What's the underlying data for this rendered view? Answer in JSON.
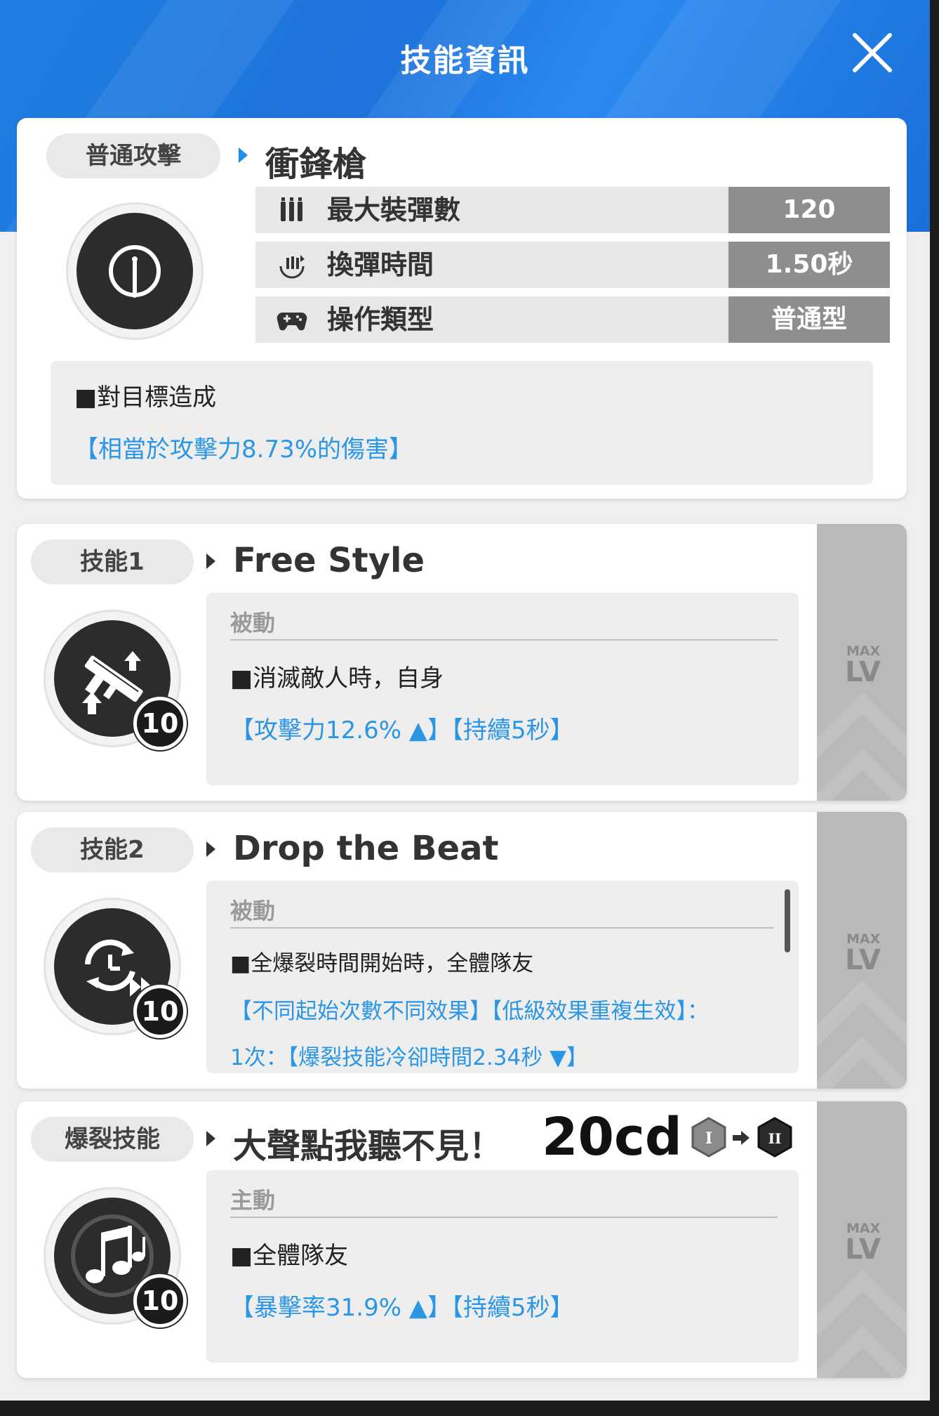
{
  "header": {
    "title": "技能資訊",
    "close_icon": "close-icon"
  },
  "basic_attack": {
    "tag": "普通攻擊",
    "weapon_name": "衝鋒槍",
    "stats": [
      {
        "icon": "ammo-icon",
        "label": "最大裝彈數",
        "value": "120"
      },
      {
        "icon": "reload-icon",
        "label": "換彈時間",
        "value": "1.50秒"
      },
      {
        "icon": "gamepad-icon",
        "label": "操作類型",
        "value": "普通型"
      }
    ],
    "desc_line1": "■對目標造成",
    "desc_line2": "【相當於攻擊力8.73%的傷害】"
  },
  "skill1": {
    "tag": "技能1",
    "name": "Free Style",
    "level": "10",
    "type": "被動",
    "desc_line1": "■消滅敵人時，自身",
    "desc_line2": "【攻擊力12.6% ▲】【持續5秒】",
    "max_label": "MAX",
    "lv_label": "LV"
  },
  "skill2": {
    "tag": "技能2",
    "name": "Drop the Beat",
    "level": "10",
    "type": "被動",
    "desc_line1": "■全爆裂時間開始時，全體隊友",
    "desc_line2": "【不同起始次數不同效果】【低級效果重複生效】：",
    "desc_line3": "1次：【爆裂技能冷卻時間2.34秒 ▼】",
    "max_label": "MAX",
    "lv_label": "LV"
  },
  "burst": {
    "tag": "爆裂技能",
    "name": "大聲點我聽不見！",
    "cd_note": "20cd",
    "stage_from": "I",
    "stage_to": "II",
    "level": "10",
    "type": "主動",
    "desc_line1": "■全體隊友",
    "desc_line2": "【暴擊率31.9% ▲】【持續5秒】",
    "max_label": "MAX",
    "lv_label": "LV"
  },
  "colors": {
    "accent_blue": "#2b96e6",
    "header_blue": "#1e78de",
    "value_gray": "#8e8e8e"
  }
}
